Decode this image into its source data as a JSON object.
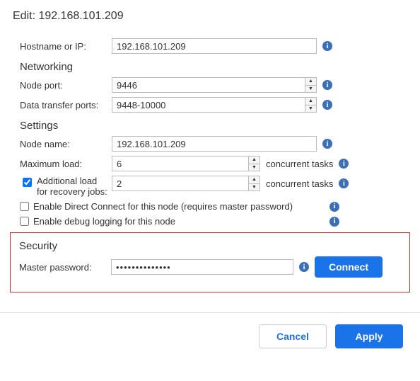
{
  "dialog": {
    "title_prefix": "Edit: ",
    "title_value": "192.168.101.209"
  },
  "hostname": {
    "label": "Hostname or IP:",
    "value": "192.168.101.209"
  },
  "networking": {
    "heading": "Networking",
    "node_port": {
      "label": "Node port:",
      "value": "9446"
    },
    "data_transfer_ports": {
      "label": "Data transfer ports:",
      "value": "9448-10000"
    }
  },
  "settings": {
    "heading": "Settings",
    "node_name": {
      "label": "Node name:",
      "value": "192.168.101.209"
    },
    "maximum_load": {
      "label": "Maximum load:",
      "value": "6",
      "suffix": "concurrent tasks"
    },
    "additional_load": {
      "checkbox_label_line1": "Additional load",
      "checkbox_label_line2": "for recovery jobs:",
      "checked": true,
      "value": "2",
      "suffix": "concurrent tasks"
    },
    "direct_connect": {
      "label": "Enable Direct Connect for this node (requires master password)",
      "checked": false
    },
    "debug_logging": {
      "label": "Enable debug logging for this node",
      "checked": false
    }
  },
  "security": {
    "heading": "Security",
    "master_password": {
      "label": "Master password:",
      "value": "••••••••••••••"
    },
    "connect_label": "Connect"
  },
  "footer": {
    "cancel": "Cancel",
    "apply": "Apply"
  },
  "glyph": {
    "spin_up": "▲",
    "spin_down": "▼",
    "info": "i"
  }
}
